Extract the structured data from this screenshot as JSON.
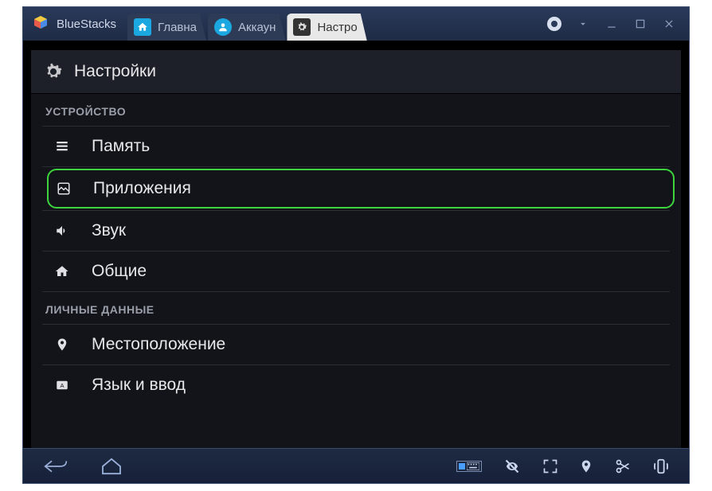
{
  "app": {
    "name": "BlueStacks"
  },
  "tabs": {
    "home": {
      "label": "Главна"
    },
    "account": {
      "label": "Аккаун"
    },
    "settings": {
      "label": "Настро"
    }
  },
  "panel": {
    "title": "Настройки"
  },
  "sections": {
    "device": {
      "header": "УСТРОЙСТВО",
      "items": {
        "memory": "Память",
        "apps": "Приложения",
        "sound": "Звук",
        "general": "Общие"
      }
    },
    "personal": {
      "header": "ЛИЧНЫЕ ДАННЫЕ",
      "items": {
        "location": "Местоположение",
        "language": "Язык и ввод"
      }
    }
  }
}
